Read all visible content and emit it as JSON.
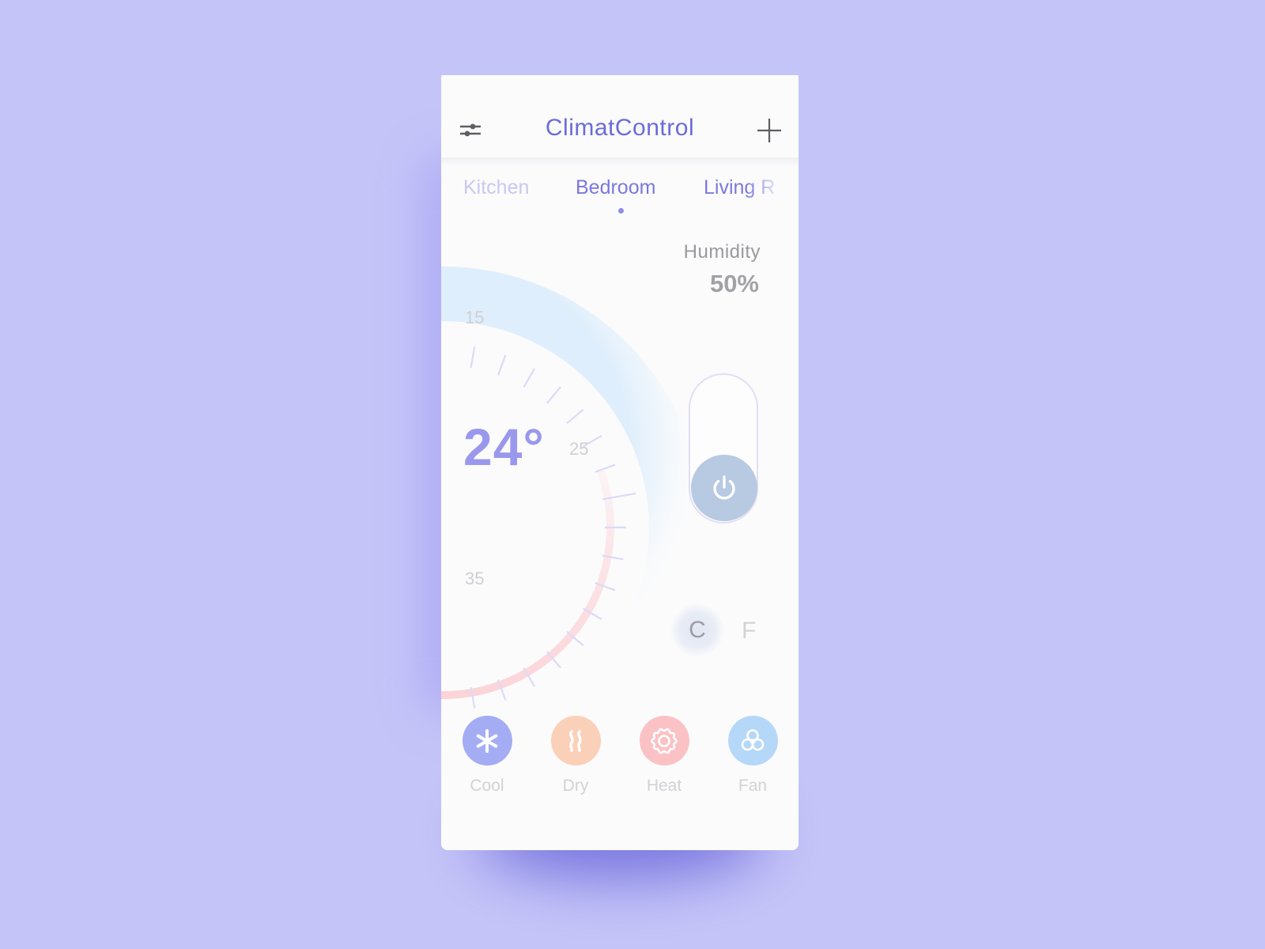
{
  "app": {
    "title": "ClimatControl",
    "settings_icon": "sliders-icon",
    "add_icon": "plus-icon"
  },
  "rooms": {
    "tabs": [
      {
        "label": "Kitchen",
        "state": "previous"
      },
      {
        "label": "Bedroom",
        "state": "active"
      },
      {
        "label": "Living Room",
        "visible_text": "Living R",
        "state": "next"
      }
    ],
    "active_index": 1
  },
  "thermostat": {
    "current_temp": "24°",
    "temp_value": 24,
    "unit": "C",
    "scale_labels": [
      "15",
      "25",
      "35"
    ],
    "scale_min": 10,
    "scale_max": 40
  },
  "humidity": {
    "label": "Humidity",
    "value": "50%"
  },
  "power": {
    "icon": "power-icon",
    "state": "off"
  },
  "units": {
    "celsius": "C",
    "fahrenheit": "F",
    "selected": "C"
  },
  "modes": [
    {
      "label": "Cool",
      "icon": "snowflake-icon",
      "color": "#a4acf4"
    },
    {
      "label": "Dry",
      "icon": "steam-icon",
      "color": "#fbd0b8"
    },
    {
      "label": "Heat",
      "icon": "sun-gear-icon",
      "color": "#fbc2c6"
    },
    {
      "label": "Fan",
      "icon": "fan-icon",
      "color": "#b6d8f8"
    }
  ],
  "colors": {
    "accent": "#6b6bd8",
    "background": "#c5c4f8",
    "card": "#fbfbfc",
    "power_knob": "#b8c9e2",
    "heat_arc": "#fbd6da"
  }
}
